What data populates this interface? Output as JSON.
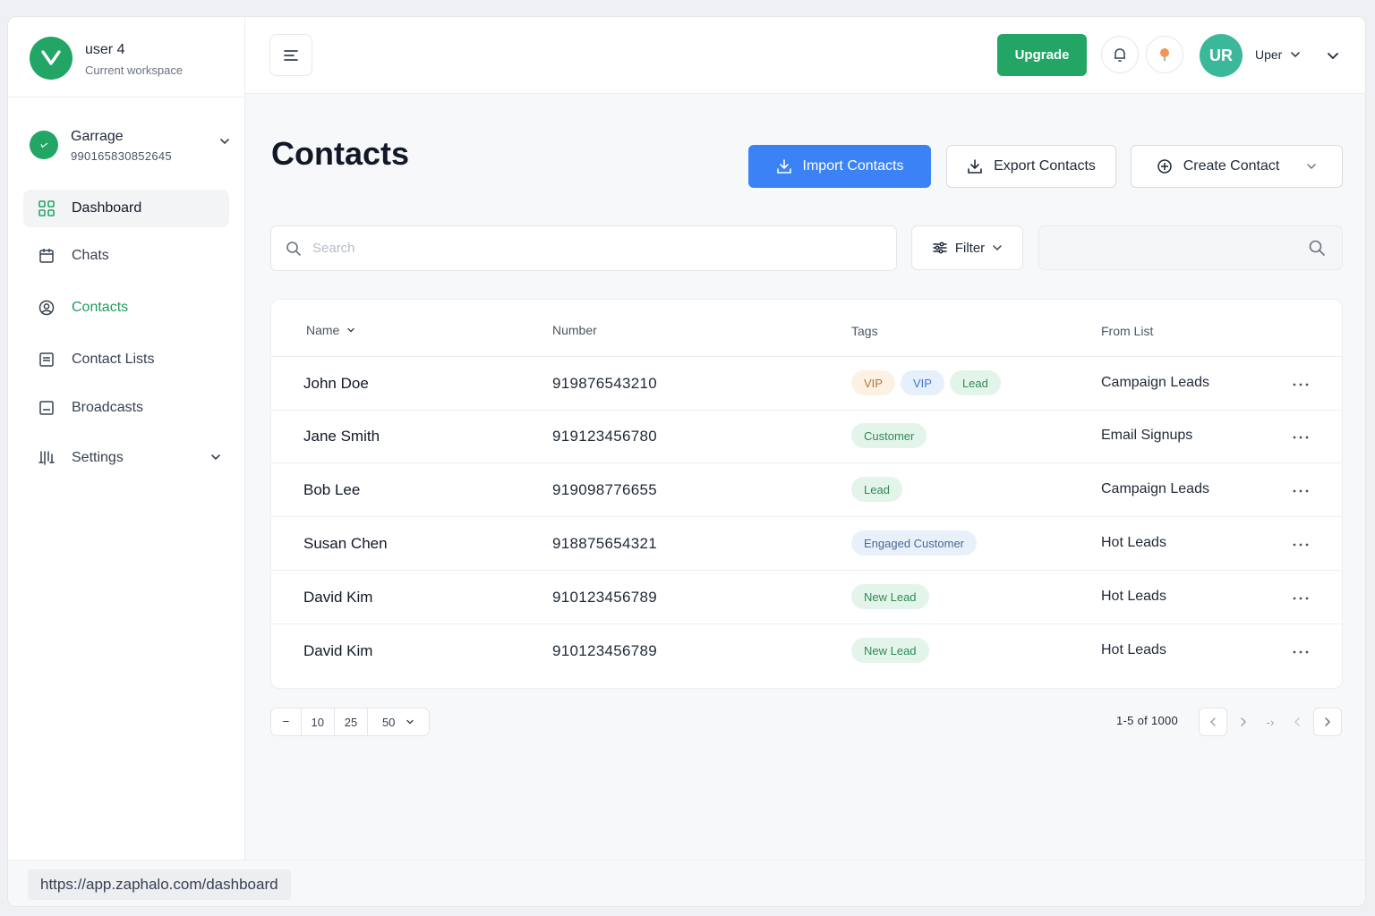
{
  "brand": {
    "user": "user 4",
    "subtitle": "Current workspace"
  },
  "workspace": {
    "name": "Garrage",
    "id": "990165830852645"
  },
  "sidebar": {
    "items": [
      {
        "label": "Dashboard",
        "icon": "grid-icon",
        "state": "active"
      },
      {
        "label": "Chats",
        "icon": "calendar-icon"
      },
      {
        "label": "Contacts",
        "icon": "user-circle-icon",
        "state": "current"
      },
      {
        "label": "Contact Lists",
        "icon": "list-icon"
      },
      {
        "label": "Broadcasts",
        "icon": "broadcast-icon"
      },
      {
        "label": "Settings",
        "icon": "sliders-icon"
      }
    ]
  },
  "header": {
    "upgrade_label": "Upgrade",
    "avatar_initials": "UR",
    "user_label": "Uper"
  },
  "main": {
    "title": "Contacts",
    "import_label": "Import Contacts",
    "export_label": "Export Contacts",
    "create_label": "Create Contact",
    "search_placeholder": "Search",
    "filter_label": "Filter"
  },
  "table": {
    "columns": [
      "Name",
      "Number",
      "Tags",
      "From List"
    ],
    "rows": [
      {
        "name": "John Doe",
        "number": "919876543210",
        "tags": [
          {
            "label": "VIP",
            "color": "orange"
          },
          {
            "label": "VIP",
            "color": "blue"
          },
          {
            "label": "Lead",
            "color": "green"
          }
        ],
        "list": "Campaign Leads"
      },
      {
        "name": "Jane Smith",
        "number": "919123456780",
        "tags": [
          {
            "label": "Customer",
            "color": "green"
          }
        ],
        "list": "Email Signups"
      },
      {
        "name": "Bob Lee",
        "number": "919098776655",
        "tags": [
          {
            "label": "Lead",
            "color": "green"
          }
        ],
        "list": "Campaign Leads"
      },
      {
        "name": "Susan Chen",
        "number": "918875654321",
        "tags": [
          {
            "label": "Engaged Customer",
            "color": "slate"
          }
        ],
        "list": "Hot Leads"
      },
      {
        "name": "David Kim",
        "number": "910123456789",
        "tags": [
          {
            "label": "New Lead",
            "color": "green"
          }
        ],
        "list": "Hot Leads"
      },
      {
        "name": "David Kim",
        "number": "910123456789",
        "tags": [
          {
            "label": "New Lead",
            "color": "green"
          }
        ],
        "list": "Hot Leads"
      }
    ]
  },
  "pagination": {
    "sizes": [
      "10",
      "25",
      "50"
    ],
    "info": "1-5 of 1000",
    "first_glyph": "ⲻ",
    "skip_glyph": "-›"
  },
  "statusbar": {
    "url": "https://app.zaphalo.com/dashboard"
  },
  "colors": {
    "brand_green": "#22a565",
    "import_blue": "#3b82f6",
    "avatar_teal": "#3bb79a"
  }
}
